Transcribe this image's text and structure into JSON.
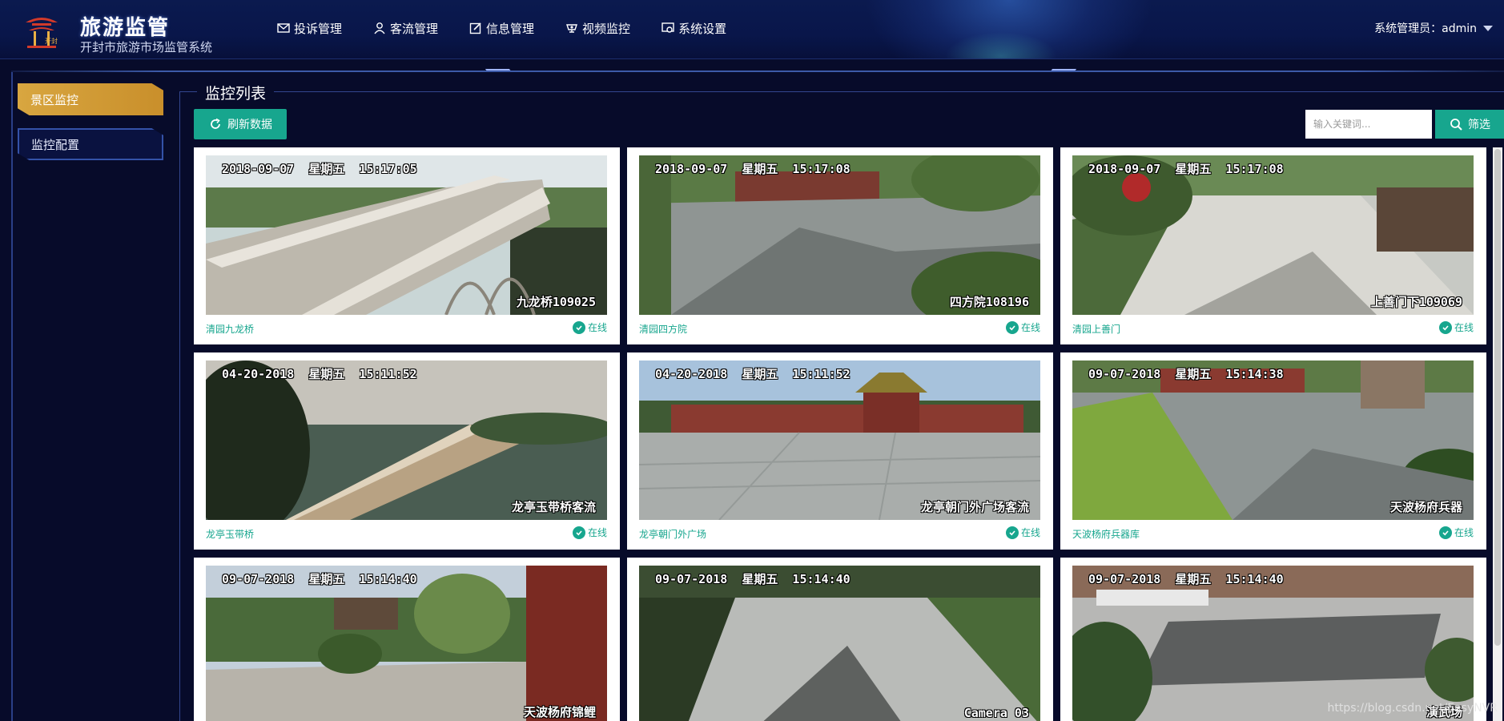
{
  "app": {
    "logo_title": "旅游监管",
    "logo_subtitle": "开封市旅游市场监管系统",
    "logo_mark_text": "开封"
  },
  "nav": [
    {
      "label": "投诉管理",
      "icon": "complaint-icon"
    },
    {
      "label": "客流管理",
      "icon": "user-icon"
    },
    {
      "label": "信息管理",
      "icon": "edit-icon"
    },
    {
      "label": "视频监控",
      "icon": "camera-icon"
    },
    {
      "label": "系统设置",
      "icon": "settings-icon"
    }
  ],
  "user": {
    "text": "系统管理员：admin"
  },
  "sidebar": {
    "items": [
      {
        "label": "景区监控",
        "active": true
      },
      {
        "label": "监控配置",
        "active": false
      }
    ]
  },
  "main": {
    "section_title": "监控列表",
    "refresh_label": "刷新数据",
    "search_placeholder": "输入关键词...",
    "filter_label": "筛选"
  },
  "cameras": [
    {
      "name": "清园九龙桥",
      "status": "在线",
      "osd_time": "2018-09-07  星期五  15:17:05",
      "osd_label": "九龙桥109025"
    },
    {
      "name": "清园四方院",
      "status": "在线",
      "osd_time": "2018-09-07  星期五  15:17:08",
      "osd_label": "四方院108196"
    },
    {
      "name": "清园上善门",
      "status": "在线",
      "osd_time": "2018-09-07  星期五  15:17:08",
      "osd_label": "上善门下109069"
    },
    {
      "name": "龙亭玉带桥",
      "status": "在线",
      "osd_time": "04-20-2018  星期五  15:11:52",
      "osd_label": "龙亭玉带桥客流"
    },
    {
      "name": "龙亭朝门外广场",
      "status": "在线",
      "osd_time": "04-20-2018  星期五  15:11:52",
      "osd_label": "龙亭朝门外广场客流"
    },
    {
      "name": "天波杨府兵器库",
      "status": "在线",
      "osd_time": "09-07-2018  星期五  15:14:38",
      "osd_label": "天波杨府兵器"
    },
    {
      "name": "",
      "status": "",
      "osd_time": "09-07-2018  星期五  15:14:40",
      "osd_label": "天波杨府锦鲤"
    },
    {
      "name": "",
      "status": "",
      "osd_time": "09-07-2018  星期五  15:14:40",
      "osd_label": "Camera 03"
    },
    {
      "name": "",
      "status": "",
      "osd_time": "09-07-2018  星期五  15:14:40",
      "osd_label": "演武场"
    }
  ],
  "watermark": "https://blog.csdn.net/EasyNVR",
  "colors": {
    "accent": "#17a68e",
    "background": "#070b2a",
    "header": "#0b1a4f",
    "sidebar_active": "#d8a640",
    "frame": "#33468f"
  }
}
